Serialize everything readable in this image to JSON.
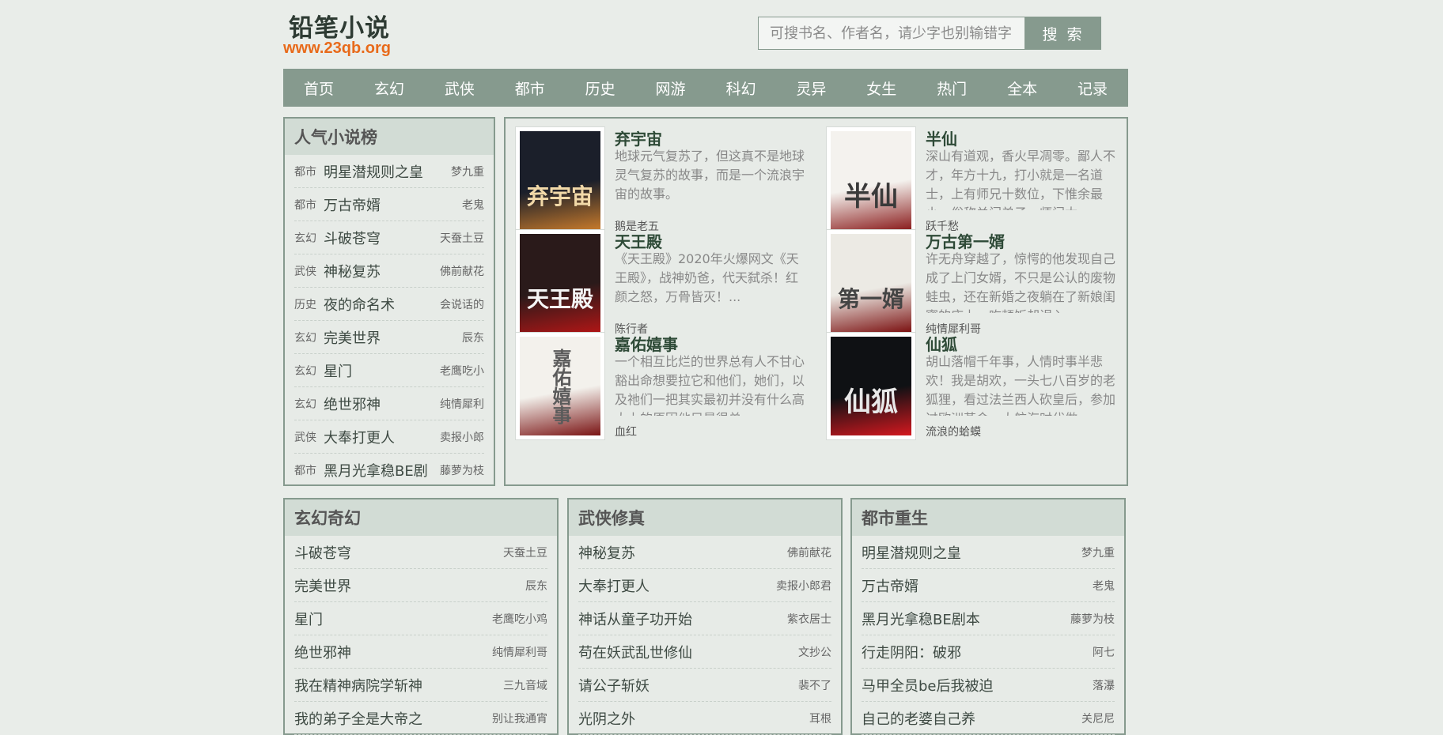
{
  "site": {
    "name": "铅笔小说",
    "url": "www.23qb.org"
  },
  "search": {
    "placeholder": "可搜书名、作者名，请少字也别输错字",
    "button_label": "搜 索"
  },
  "nav": [
    "首页",
    "玄幻",
    "武侠",
    "都市",
    "历史",
    "网游",
    "科幻",
    "灵异",
    "女生",
    "热门",
    "全本",
    "记录"
  ],
  "rank": {
    "title": "人气小说榜",
    "items": [
      {
        "cat": "都市",
        "title": "明星潜规则之皇",
        "author": "梦九重"
      },
      {
        "cat": "都市",
        "title": "万古帝婿",
        "author": "老鬼"
      },
      {
        "cat": "玄幻",
        "title": "斗破苍穹",
        "author": "天蚕土豆"
      },
      {
        "cat": "武侠",
        "title": "神秘复苏",
        "author": "佛前献花"
      },
      {
        "cat": "历史",
        "title": "夜的命名术",
        "author": "会说话的"
      },
      {
        "cat": "玄幻",
        "title": "完美世界",
        "author": "辰东"
      },
      {
        "cat": "玄幻",
        "title": "星门",
        "author": "老鹰吃小"
      },
      {
        "cat": "玄幻",
        "title": "绝世邪神",
        "author": "纯情犀利"
      },
      {
        "cat": "武侠",
        "title": "大奉打更人",
        "author": "卖报小郎"
      },
      {
        "cat": "都市",
        "title": "黑月光拿稳BE剧",
        "author": "藤萝为枝"
      }
    ]
  },
  "featured": [
    {
      "title": "弃宇宙",
      "desc": "地球元气复苏了，但这真不是地球灵气复苏的故事，而是一个流浪宇宙的故事。",
      "author": "鹅是老五",
      "cover_text": "弃宇宙",
      "cover_colors": [
        "#1b1f2a",
        "#c77a2b",
        "#f2d9a8"
      ]
    },
    {
      "title": "半仙",
      "desc": "深山有道观，香火早凋零。鄙人不才，年方十九，打小就是一名道士，上有师兄十数位，下惟余最小，俗称关门弟子。师门太",
      "author": "跃千愁",
      "cover_text": "半仙",
      "cover_colors": [
        "#f4f2ee",
        "#8a1c1c",
        "#3a3a3a"
      ]
    },
    {
      "title": "天王殿",
      "desc": "《天王殿》2020年火爆网文《天王殿》，战神奶爸，代天弑杀！红颜之怒，万骨皆灭！...",
      "author": "陈行者",
      "cover_text": "天王殿",
      "cover_colors": [
        "#2a1a1a",
        "#b01616",
        "#f5f5f5"
      ]
    },
    {
      "title": "万古第一婿",
      "desc": "许无舟穿越了，惊愕的他发现自己成了上门女婿，不只是公认的废物蛙虫，还在新婚之夜躺在了新娘闺蜜的床上。吃顿饭却误入",
      "author": "纯情犀利哥",
      "cover_text": "第一婿",
      "cover_colors": [
        "#eceae4",
        "#7a0f0f",
        "#444444"
      ]
    },
    {
      "title": "嘉佑嬉事",
      "desc": "一个相互比烂的世界总有人不甘心豁出命想要拉它和他们，她们，以及祂们一把其实最初并没有什么高大上的原因他只是很单",
      "author": "血红",
      "cover_text": "嘉佑嬉事",
      "cover_colors": [
        "#f3f1ec",
        "#7a1414",
        "#5b5b5b"
      ]
    },
    {
      "title": "仙狐",
      "desc": "胡山落帽千年事，人情时事半悲欢！我是胡欢，一头七八百岁的老狐狸，看过法兰西人砍皇后，参加过欧洲革命，大航海时代做",
      "author": "流浪的蛤蟆",
      "cover_text": "仙狐",
      "cover_colors": [
        "#0f1114",
        "#d4181f",
        "#e8e8e8"
      ]
    }
  ],
  "categories": [
    {
      "title": "玄幻奇幻",
      "items": [
        {
          "title": "斗破苍穹",
          "author": "天蚕土豆"
        },
        {
          "title": "完美世界",
          "author": "辰东"
        },
        {
          "title": "星门",
          "author": "老鹰吃小鸡"
        },
        {
          "title": "绝世邪神",
          "author": "纯情犀利哥"
        },
        {
          "title": "我在精神病院学斩神",
          "author": "三九音域"
        },
        {
          "title": "我的弟子全是大帝之",
          "author": "别让我通宵"
        }
      ]
    },
    {
      "title": "武侠修真",
      "items": [
        {
          "title": "神秘复苏",
          "author": "佛前献花"
        },
        {
          "title": "大奉打更人",
          "author": "卖报小郎君"
        },
        {
          "title": "神话从童子功开始",
          "author": "紫衣居士"
        },
        {
          "title": "苟在妖武乱世修仙",
          "author": "文抄公"
        },
        {
          "title": "请公子斩妖",
          "author": "裴不了"
        },
        {
          "title": "光阴之外",
          "author": "耳根"
        }
      ]
    },
    {
      "title": "都市重生",
      "items": [
        {
          "title": "明星潜规则之皇",
          "author": "梦九重"
        },
        {
          "title": "万古帝婿",
          "author": "老鬼"
        },
        {
          "title": "黑月光拿稳BE剧本",
          "author": "藤萝为枝"
        },
        {
          "title": "行走阴阳：破邪",
          "author": "阿七"
        },
        {
          "title": "马甲全员be后我被迫",
          "author": "落瀑"
        },
        {
          "title": "自己的老婆自己养",
          "author": "关尼尼"
        }
      ]
    }
  ]
}
